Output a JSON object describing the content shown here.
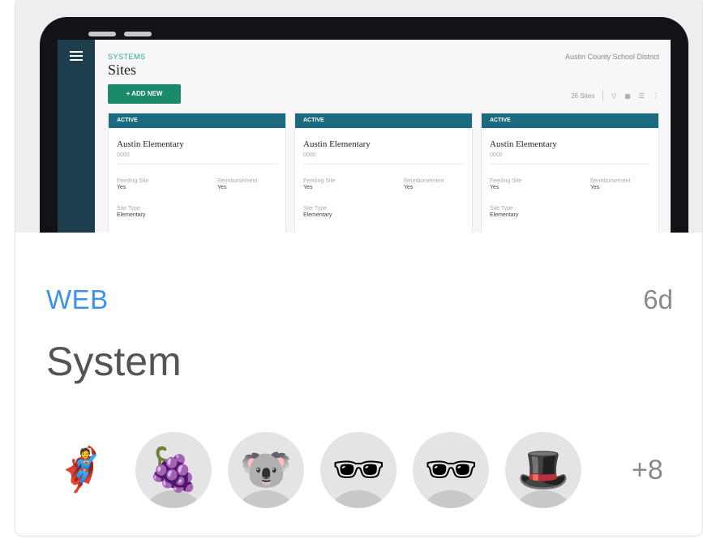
{
  "preview": {
    "app": {
      "breadcrumb": "SYSTEMS",
      "page_title": "Sites",
      "district": "Austin County School District",
      "add_button": "+ ADD NEW",
      "count": "26 Sites",
      "cards": [
        {
          "status": "ACTIVE",
          "name": "Austin Elementary",
          "code": "0000",
          "feeding_label": "Feeding Site",
          "feeding_value": "Yes",
          "reimb_label": "Reimbursement",
          "reimb_value": "Yes",
          "type_label": "Site Type",
          "type_value": "Elementary"
        },
        {
          "status": "ACTIVE",
          "name": "Austin Elementary",
          "code": "0000",
          "feeding_label": "Feeding Site",
          "feeding_value": "Yes",
          "reimb_label": "Reimbursement",
          "reimb_value": "Yes",
          "type_label": "Site Type",
          "type_value": "Elementary"
        },
        {
          "status": "ACTIVE",
          "name": "Austin Elementary",
          "code": "0000",
          "feeding_label": "Feeding Site",
          "feeding_value": "Yes",
          "reimb_label": "Reimbursement",
          "reimb_value": "Yes",
          "type_label": "Site Type",
          "type_value": "Elementary"
        }
      ]
    }
  },
  "card": {
    "category": "WEB",
    "age": "6d",
    "title": "System",
    "category_color": "#3b93ee"
  },
  "members": {
    "avatars": [
      {
        "name": "deadpool-avatar",
        "glyph": "🦸"
      },
      {
        "name": "grapes-avatar",
        "glyph": "🍇"
      },
      {
        "name": "koala-avatar",
        "glyph": "🐨"
      },
      {
        "name": "sunglasses-avatar",
        "glyph": "🕶"
      },
      {
        "name": "sunglasses-avatar",
        "glyph": "🕶"
      },
      {
        "name": "top-hat-avatar",
        "glyph": "🎩"
      }
    ],
    "more_count": "+8"
  }
}
